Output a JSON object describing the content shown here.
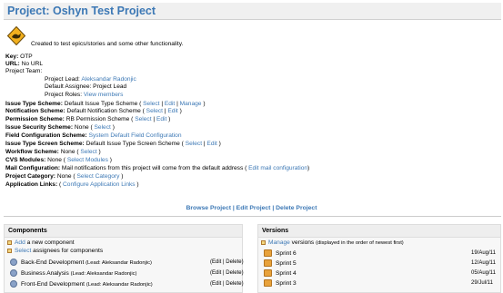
{
  "page": {
    "title": "Project: Oshyn Test Project"
  },
  "project": {
    "description": "Created to test epics/stories and some other functionality.",
    "key_label": "Key:",
    "key_value": "OTP",
    "url_label": "URL:",
    "url_value": "No URL",
    "team_label": "Project Team:",
    "lead_label": "Project Lead:",
    "lead_value": "Aleksandar Radonjic",
    "assignee_label": "Default Assignee:",
    "assignee_value": "Project Lead",
    "roles_label": "Project Roles:",
    "roles_link": "View members",
    "its_label": "Issue Type Scheme:",
    "its_value": "Default Issue Type Scheme (",
    "ns_label": "Notification Scheme:",
    "ns_value": "Default Notification Scheme (",
    "ps_label": "Permission Scheme:",
    "ps_value": "RB Permission Scheme (",
    "iss_label": "Issue Security Scheme:",
    "iss_value": "None (",
    "fcs_label": "Field Configuration Scheme:",
    "fcs_link": "System Default Field Configuration",
    "itss_label": "Issue Type Screen Scheme:",
    "itss_value": "Default Issue Type Screen Scheme (",
    "ws_label": "Workflow Scheme:",
    "ws_value": "None (",
    "cvs_label": "CVS Modules:",
    "cvs_value": "None (",
    "cvs_link": "Select Modules",
    "mail_label": "Mail Configuration:",
    "mail_value": "Mail notifications from this project will come from the default address (",
    "mail_link": "Edit mail configuration",
    "cat_label": "Project Category:",
    "cat_value": "None (",
    "cat_link": "Select Category",
    "app_label": "Application Links:",
    "app_open": "(",
    "app_link": "Configure Application Links",
    "select": "Select",
    "edit": "Edit",
    "manage": "Manage",
    "sep": " | ",
    "close": " )",
    "close_paren": ")"
  },
  "actions": {
    "browse": "Browse Project",
    "edit": "Edit Project",
    "delete": "Delete Project",
    "sep": " | "
  },
  "components": {
    "header": "Components",
    "add_link": "Add",
    "add_text": " a new component",
    "select_link": "Select",
    "select_text": " assignees for components",
    "items": [
      {
        "name": "Back-End Development",
        "lead": "(Lead: Aleksandar Radonjic)",
        "actions": "(Edit | Delete)"
      },
      {
        "name": "Business Analysis",
        "lead": "(Lead: Aleksandar Radonjic)",
        "actions": "(Edit | Delete)"
      },
      {
        "name": "Front-End Development",
        "lead": "(Lead: Aleksandar Radonjic)",
        "actions": "(Edit | Delete)"
      }
    ]
  },
  "versions": {
    "header": "Versions",
    "manage_link": "Manage",
    "manage_text": " versions",
    "manage_note": "(displayed in the order of newest first)",
    "items": [
      {
        "name": "Sprint 6",
        "date": "19/Aug/11"
      },
      {
        "name": "Sprint 5",
        "date": "12/Aug/11"
      },
      {
        "name": "Sprint 4",
        "date": "05/Aug/11"
      },
      {
        "name": "Sprint 3",
        "date": "29/Jul/11"
      }
    ]
  },
  "colors": {
    "link": "#3c78b5",
    "title_bg": "#f0f0f0",
    "panel_bg": "#f7f7f7"
  }
}
